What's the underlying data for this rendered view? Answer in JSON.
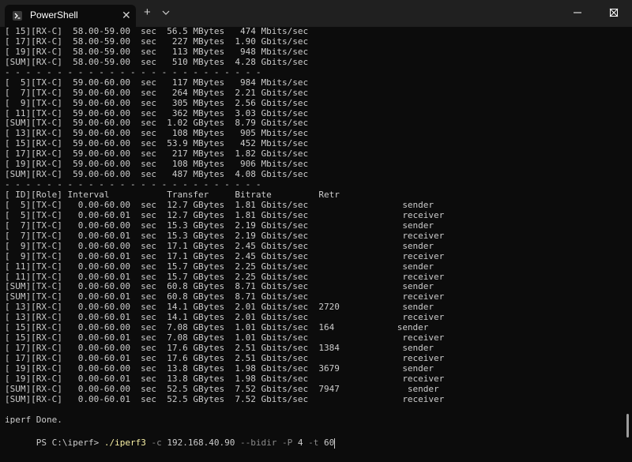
{
  "tab": {
    "title": "PowerShell",
    "close_glyph": "✕",
    "icon": "powershell-icon"
  },
  "new_tab": "+",
  "window_controls": [
    "minimize-icon",
    "maximize-icon",
    "close-icon"
  ],
  "lines": [
    "[ 15][RX-C]  58.00-59.00  sec  56.5 MBytes   474 Mbits/sec",
    "[ 17][RX-C]  58.00-59.00  sec   227 MBytes  1.90 Gbits/sec",
    "[ 19][RX-C]  58.00-59.00  sec   113 MBytes   948 Mbits/sec",
    "[SUM][RX-C]  58.00-59.00  sec   510 MBytes  4.28 Gbits/sec",
    "- - - - - - - - - - - - - - - - - - - - - - - - -",
    "[  5][TX-C]  59.00-60.00  sec   117 MBytes   984 Mbits/sec",
    "[  7][TX-C]  59.00-60.00  sec   264 MBytes  2.21 Gbits/sec",
    "[  9][TX-C]  59.00-60.00  sec   305 MBytes  2.56 Gbits/sec",
    "[ 11][TX-C]  59.00-60.00  sec   362 MBytes  3.03 Gbits/sec",
    "[SUM][TX-C]  59.00-60.00  sec  1.02 GBytes  8.79 Gbits/sec",
    "[ 13][RX-C]  59.00-60.00  sec   108 MBytes   905 Mbits/sec",
    "[ 15][RX-C]  59.00-60.00  sec  53.9 MBytes   452 Mbits/sec",
    "[ 17][RX-C]  59.00-60.00  sec   217 MBytes  1.82 Gbits/sec",
    "[ 19][RX-C]  59.00-60.00  sec   108 MBytes   906 Mbits/sec",
    "[SUM][RX-C]  59.00-60.00  sec   487 MBytes  4.08 Gbits/sec",
    "- - - - - - - - - - - - - - - - - - - - - - - - -",
    "[ ID][Role] Interval           Transfer     Bitrate         Retr",
    "[  5][TX-C]   0.00-60.00  sec  12.7 GBytes  1.81 Gbits/sec                  sender",
    "[  5][TX-C]   0.00-60.01  sec  12.7 GBytes  1.81 Gbits/sec                  receiver",
    "[  7][TX-C]   0.00-60.00  sec  15.3 GBytes  2.19 Gbits/sec                  sender",
    "[  7][TX-C]   0.00-60.01  sec  15.3 GBytes  2.19 Gbits/sec                  receiver",
    "[  9][TX-C]   0.00-60.00  sec  17.1 GBytes  2.45 Gbits/sec                  sender",
    "[  9][TX-C]   0.00-60.01  sec  17.1 GBytes  2.45 Gbits/sec                  receiver",
    "[ 11][TX-C]   0.00-60.00  sec  15.7 GBytes  2.25 Gbits/sec                  sender",
    "[ 11][TX-C]   0.00-60.01  sec  15.7 GBytes  2.25 Gbits/sec                  receiver",
    "[SUM][TX-C]   0.00-60.00  sec  60.8 GBytes  8.71 Gbits/sec                  sender",
    "[SUM][TX-C]   0.00-60.01  sec  60.8 GBytes  8.71 Gbits/sec                  receiver",
    "[ 13][RX-C]   0.00-60.00  sec  14.1 GBytes  2.01 Gbits/sec  2720            sender",
    "[ 13][RX-C]   0.00-60.01  sec  14.1 GBytes  2.01 Gbits/sec                  receiver",
    "[ 15][RX-C]   0.00-60.00  sec  7.08 GBytes  1.01 Gbits/sec  164            sender",
    "[ 15][RX-C]   0.00-60.01  sec  7.08 GBytes  1.01 Gbits/sec                  receiver",
    "[ 17][RX-C]   0.00-60.00  sec  17.6 GBytes  2.51 Gbits/sec  1384            sender",
    "[ 17][RX-C]   0.00-60.01  sec  17.6 GBytes  2.51 Gbits/sec                  receiver",
    "[ 19][RX-C]   0.00-60.00  sec  13.8 GBytes  1.98 Gbits/sec  3679            sender",
    "[ 19][RX-C]   0.00-60.01  sec  13.8 GBytes  1.98 Gbits/sec                  receiver",
    "[SUM][RX-C]   0.00-60.00  sec  52.5 GBytes  7.52 Gbits/sec  7947             sender",
    "[SUM][RX-C]   0.00-60.01  sec  52.5 GBytes  7.52 Gbits/sec                  receiver",
    "",
    "iperf Done."
  ],
  "prompt": {
    "prefix": "PS C:\\iperf> ",
    "command": "./iperf3",
    "parts": [
      {
        "text": " -c",
        "kind": "param"
      },
      {
        "text": " 192.168.40.90",
        "kind": "arg"
      },
      {
        "text": " --bidir",
        "kind": "param"
      },
      {
        "text": " -P",
        "kind": "param"
      },
      {
        "text": " 4",
        "kind": "arg"
      },
      {
        "text": " -t",
        "kind": "param"
      },
      {
        "text": " 60",
        "kind": "arg"
      }
    ]
  },
  "colors": {
    "background": "#0c0c0c",
    "text": "#cccccc",
    "command": "#f9f1a5",
    "param": "#8a8a8a",
    "titlebar": "#202020"
  }
}
